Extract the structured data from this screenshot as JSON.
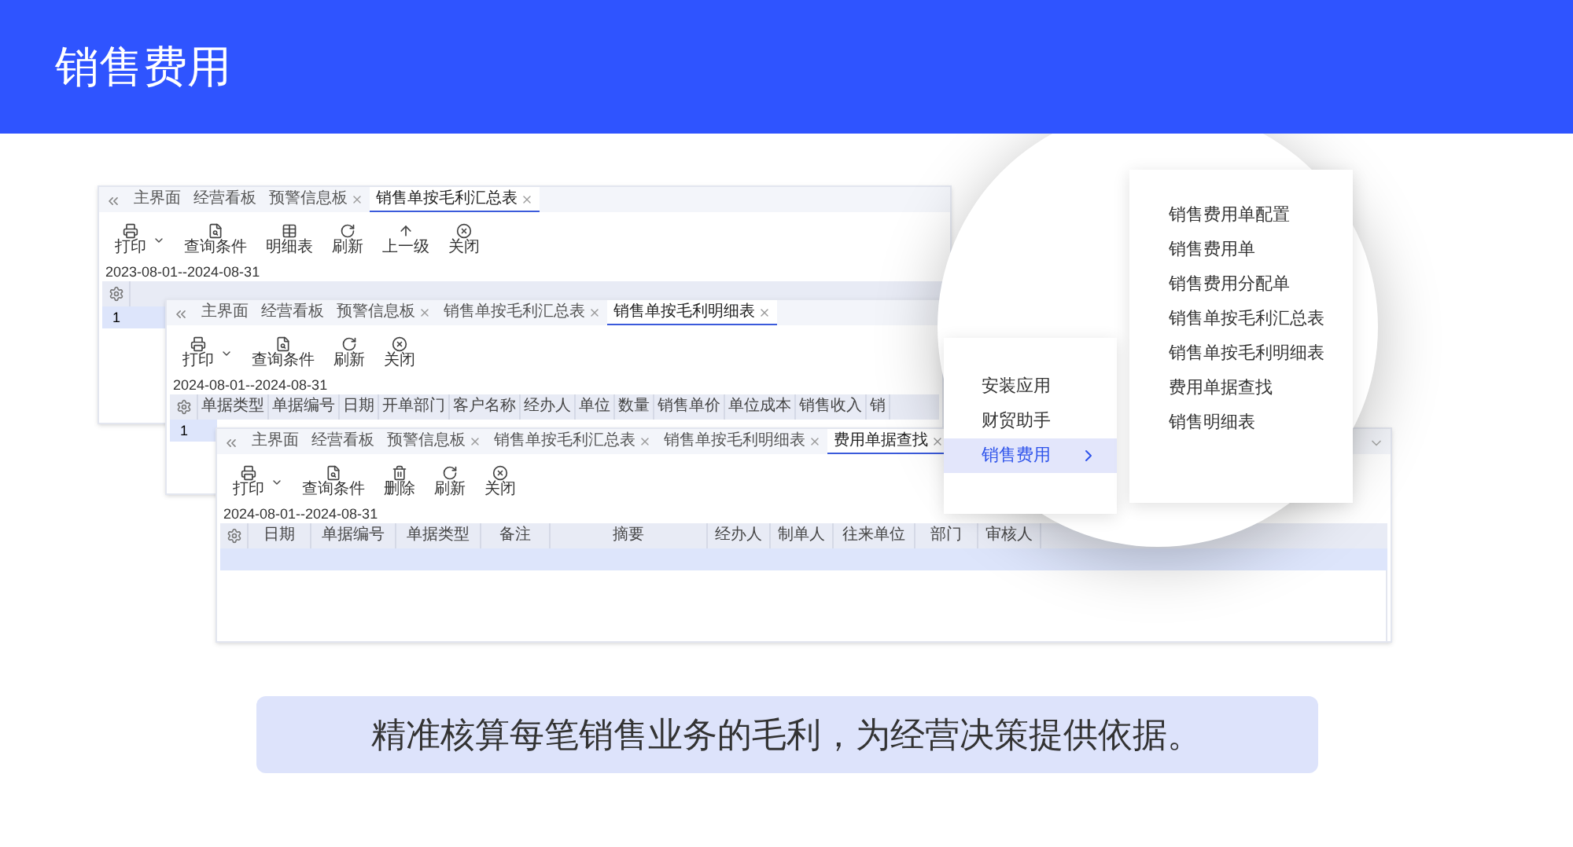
{
  "header": {
    "title": "销售费用"
  },
  "windows": [
    {
      "tabs": [
        {
          "label": "主界面",
          "closable": false,
          "selected": false
        },
        {
          "label": "经营看板",
          "closable": false,
          "selected": false
        },
        {
          "label": "预警信息板",
          "closable": true,
          "selected": false
        },
        {
          "label": "销售单按毛利汇总表",
          "closable": true,
          "selected": true
        }
      ],
      "toolbar": [
        {
          "kind": "print",
          "label": "打印",
          "dropdown": true
        },
        {
          "kind": "query",
          "label": "查询条件",
          "dropdown": false
        },
        {
          "kind": "detail",
          "label": "明细表",
          "dropdown": false
        },
        {
          "kind": "refresh",
          "label": "刷新",
          "dropdown": false
        },
        {
          "kind": "up",
          "label": "上一级",
          "dropdown": false
        },
        {
          "kind": "close",
          "label": "关闭",
          "dropdown": false
        }
      ],
      "date_range": "2023-08-01--2024-08-31",
      "rows": [
        {
          "number": "1",
          "selected": true
        }
      ]
    },
    {
      "tabs": [
        {
          "label": "主界面",
          "closable": false,
          "selected": false
        },
        {
          "label": "经营看板",
          "closable": false,
          "selected": false
        },
        {
          "label": "预警信息板",
          "closable": true,
          "selected": false
        },
        {
          "label": "销售单按毛利汇总表",
          "closable": true,
          "selected": false
        },
        {
          "label": "销售单按毛利明细表",
          "closable": true,
          "selected": true
        }
      ],
      "toolbar": [
        {
          "kind": "print",
          "label": "打印",
          "dropdown": true
        },
        {
          "kind": "query",
          "label": "查询条件",
          "dropdown": false
        },
        {
          "kind": "refresh",
          "label": "刷新",
          "dropdown": false
        },
        {
          "kind": "close",
          "label": "关闭",
          "dropdown": false
        }
      ],
      "date_range": "2024-08-01--2024-08-31",
      "columns": [
        "单据类型",
        "单据编号",
        "日期",
        "开单部门",
        "客户名称",
        "经办人",
        "单位",
        "数量",
        "销售单价",
        "单位成本",
        "销售收入",
        "销"
      ],
      "rows": [
        {
          "number": "1",
          "selected": true
        }
      ]
    },
    {
      "tabs": [
        {
          "label": "主界面",
          "closable": false,
          "selected": false
        },
        {
          "label": "经营看板",
          "closable": false,
          "selected": false
        },
        {
          "label": "预警信息板",
          "closable": true,
          "selected": false
        },
        {
          "label": "销售单按毛利汇总表",
          "closable": true,
          "selected": false
        },
        {
          "label": "销售单按毛利明细表",
          "closable": true,
          "selected": false
        },
        {
          "label": "费用单据查找",
          "closable": true,
          "selected": true
        }
      ],
      "toolbar": [
        {
          "kind": "print",
          "label": "打印",
          "dropdown": true
        },
        {
          "kind": "query",
          "label": "查询条件",
          "dropdown": false
        },
        {
          "kind": "delete",
          "label": "删除",
          "dropdown": false
        },
        {
          "kind": "refresh",
          "label": "刷新",
          "dropdown": false
        },
        {
          "kind": "close",
          "label": "关闭",
          "dropdown": false
        }
      ],
      "date_range": "2024-08-01--2024-08-31",
      "columns": [
        "日期",
        "单据编号",
        "单据类型",
        "备注",
        "摘要",
        "经办人",
        "制单人",
        "往来单位",
        "部门",
        "审核人"
      ],
      "rows": [
        {
          "selected": true
        }
      ]
    }
  ],
  "menu": [
    {
      "label": "安装应用",
      "selected": false,
      "has_submenu": false
    },
    {
      "label": "财贸助手",
      "selected": false,
      "has_submenu": false
    },
    {
      "label": "销售费用",
      "selected": true,
      "has_submenu": true
    }
  ],
  "submenu": [
    "销售费用单配置",
    "销售费用单",
    "销售费用分配单",
    "销售单按毛利汇总表",
    "销售单按毛利明细表",
    "费用单据查找",
    "销售明细表"
  ],
  "caption": "精准核算每笔销售业务的毛利，为经营决策提供依据。"
}
